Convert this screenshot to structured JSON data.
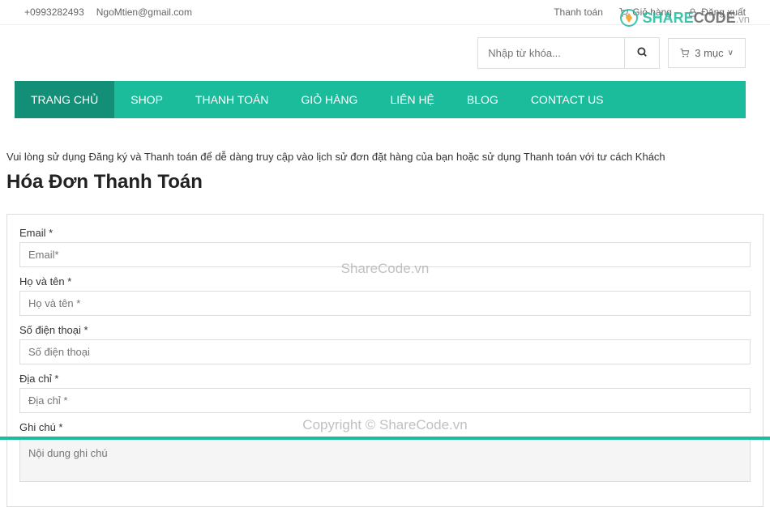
{
  "topbar": {
    "phone": "+0993282493",
    "email": "NgoMtien@gmail.com",
    "checkout_link": "Thanh toán",
    "cart_link": "Giỏ hàng",
    "logout_link": "Đăng xuất"
  },
  "header": {
    "search_placeholder": "Nhập từ khóa...",
    "cart_count": "3 mục",
    "cart_caret": "∨"
  },
  "nav": {
    "items": [
      {
        "label": "TRANG CHỦ",
        "active": true
      },
      {
        "label": "SHOP",
        "active": false
      },
      {
        "label": "THANH TOÁN",
        "active": false
      },
      {
        "label": "GIỎ HÀNG",
        "active": false
      },
      {
        "label": "LIÊN HỆ",
        "active": false
      },
      {
        "label": "BLOG",
        "active": false
      },
      {
        "label": "CONTACT US",
        "active": false
      }
    ]
  },
  "content": {
    "intro": "Vui lòng sử dụng Đăng ký và Thanh toán để dễ dàng truy cập vào lịch sử đơn đặt hàng của bạn hoặc sử dụng Thanh toán với tư cách Khách",
    "title": "Hóa Đơn Thanh Toán"
  },
  "form": {
    "email_label": "Email *",
    "email_placeholder": "Email*",
    "name_label": "Họ và tên *",
    "name_placeholder": "Họ và tên *",
    "phone_label": "Số điện thoại *",
    "phone_placeholder": "Số điện thoại",
    "address_label": "Địa chỉ *",
    "address_placeholder": "Địa chỉ *",
    "note_label": "Ghi chú *",
    "note_placeholder": "Nội dung ghi chú"
  },
  "watermark": {
    "logo_share": "SHARE",
    "logo_code": "CODE",
    "logo_vn": ".vn",
    "center": "ShareCode.vn",
    "bottom": "Copyright © ShareCode.vn"
  }
}
